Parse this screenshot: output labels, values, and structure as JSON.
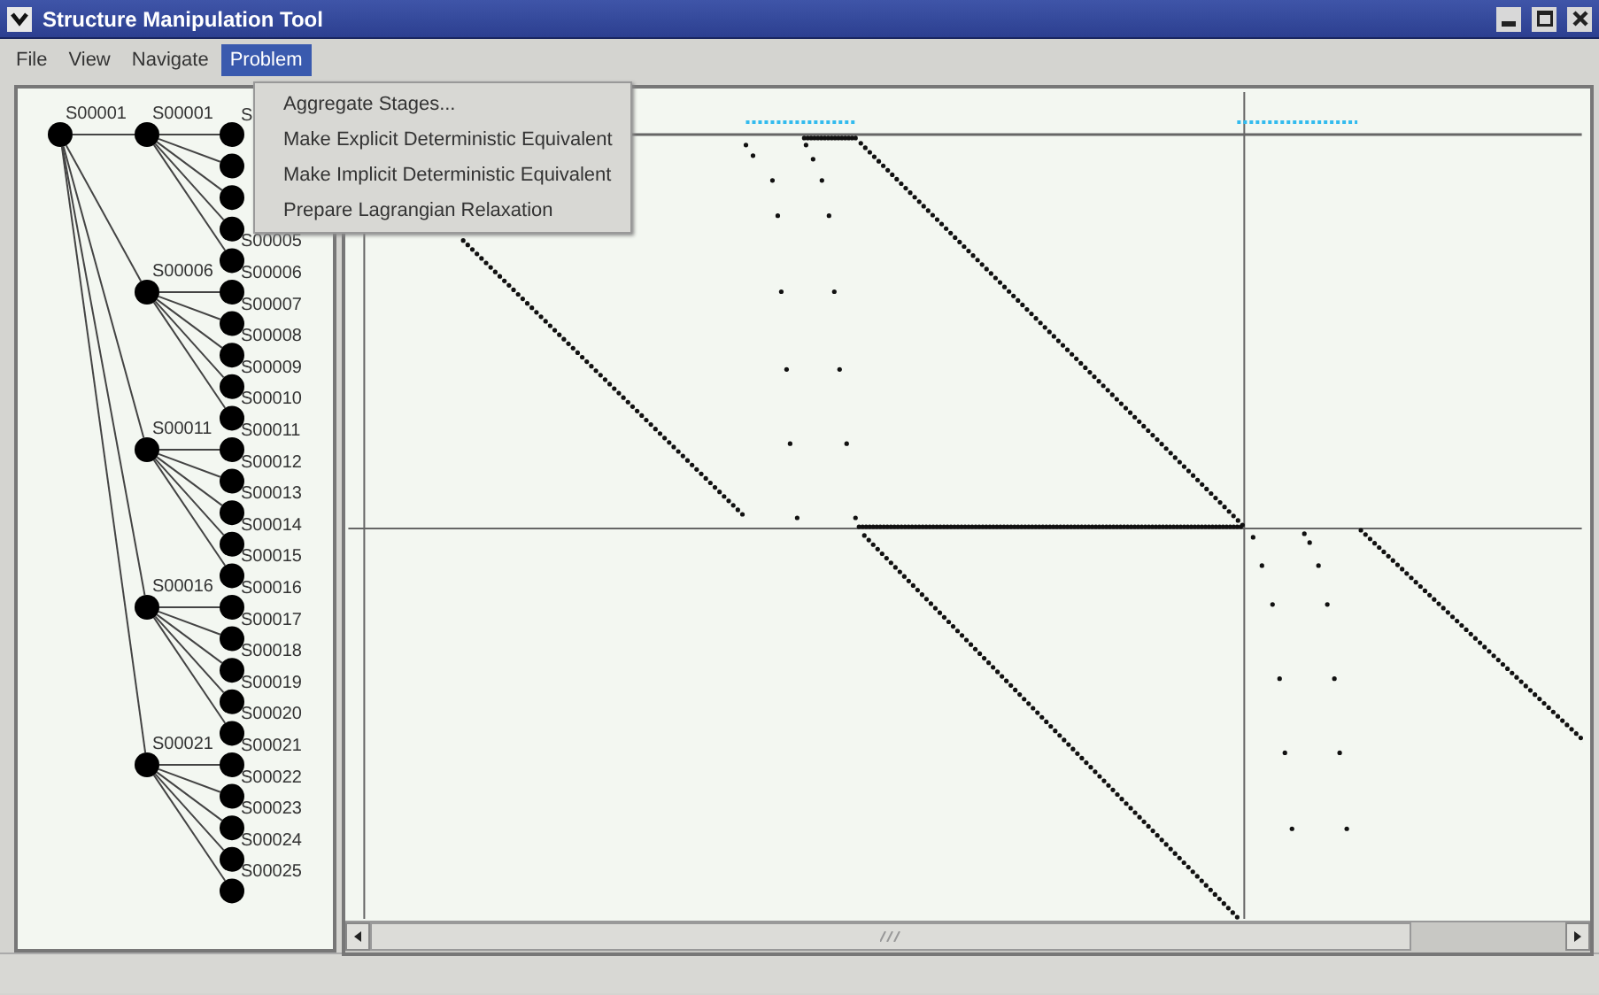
{
  "window": {
    "title": "Structure Manipulation Tool"
  },
  "menu_bar": [
    {
      "label": "File",
      "selected": false
    },
    {
      "label": "View",
      "selected": false
    },
    {
      "label": "Navigate",
      "selected": false
    },
    {
      "label": "Problem",
      "selected": true
    }
  ],
  "open_menu": {
    "items": [
      {
        "label": "Aggregate Stages..."
      },
      {
        "label": "Make Explicit Deterministic Equivalent"
      },
      {
        "label": "Make Implicit Deterministic Equivalent"
      },
      {
        "label": "Prepare Lagrangian Relaxation"
      }
    ]
  },
  "scenario_tree": {
    "root": {
      "label": "S00001"
    },
    "groups": [
      {
        "label": "S00001",
        "leaves": [
          {
            "kind": "labeled",
            "label": "S"
          },
          {
            "kind": "unlabeled"
          },
          {
            "kind": "unlabeled"
          },
          {
            "kind": "unlabeled"
          },
          {
            "kind": "labeled",
            "label": "S00005"
          }
        ]
      },
      {
        "label": "S00006",
        "leaves": [
          {
            "kind": "labeled",
            "label": "S00006"
          },
          {
            "kind": "labeled",
            "label": "S00007"
          },
          {
            "kind": "labeled",
            "label": "S00008"
          },
          {
            "kind": "labeled",
            "label": "S00009"
          },
          {
            "kind": "labeled",
            "label": "S00010"
          }
        ]
      },
      {
        "label": "S00011",
        "leaves": [
          {
            "kind": "labeled",
            "label": "S00011"
          },
          {
            "kind": "labeled",
            "label": "S00012"
          },
          {
            "kind": "labeled",
            "label": "S00013"
          },
          {
            "kind": "labeled",
            "label": "S00014"
          },
          {
            "kind": "labeled",
            "label": "S00015"
          }
        ]
      },
      {
        "label": "S00016",
        "leaves": [
          {
            "kind": "labeled",
            "label": "S00016"
          },
          {
            "kind": "labeled",
            "label": "S00017"
          },
          {
            "kind": "labeled",
            "label": "S00018"
          },
          {
            "kind": "labeled",
            "label": "S00019"
          },
          {
            "kind": "labeled",
            "label": "S00020"
          }
        ]
      },
      {
        "label": "S00021",
        "leaves": [
          {
            "kind": "labeled",
            "label": "S00021"
          },
          {
            "kind": "labeled",
            "label": "S00022"
          },
          {
            "kind": "labeled",
            "label": "S00023"
          },
          {
            "kind": "labeled",
            "label": "S00024"
          },
          {
            "kind": "labeled",
            "label": "S00025"
          }
        ]
      }
    ]
  }
}
